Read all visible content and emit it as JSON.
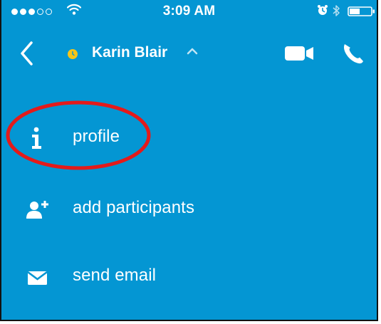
{
  "status_bar": {
    "time": "3:09 AM",
    "signal_filled": 3,
    "signal_total": 5
  },
  "nav": {
    "contact_name": "Karin Blair",
    "icons": [
      "back-chevron-icon",
      "presence-away-icon",
      "chevron-up-icon",
      "video-call-icon",
      "phone-call-icon"
    ]
  },
  "menu": {
    "items": [
      {
        "label": "profile",
        "icon": "info-icon"
      },
      {
        "label": "add participants",
        "icon": "add-person-icon"
      },
      {
        "label": "send email",
        "icon": "envelope-icon"
      }
    ]
  },
  "annotation": {
    "highlight_color": "#e41a1a",
    "highlighted_item": "profile"
  },
  "colors": {
    "background": "#0496d3",
    "presence": "#f7c518",
    "text": "#ffffff"
  }
}
